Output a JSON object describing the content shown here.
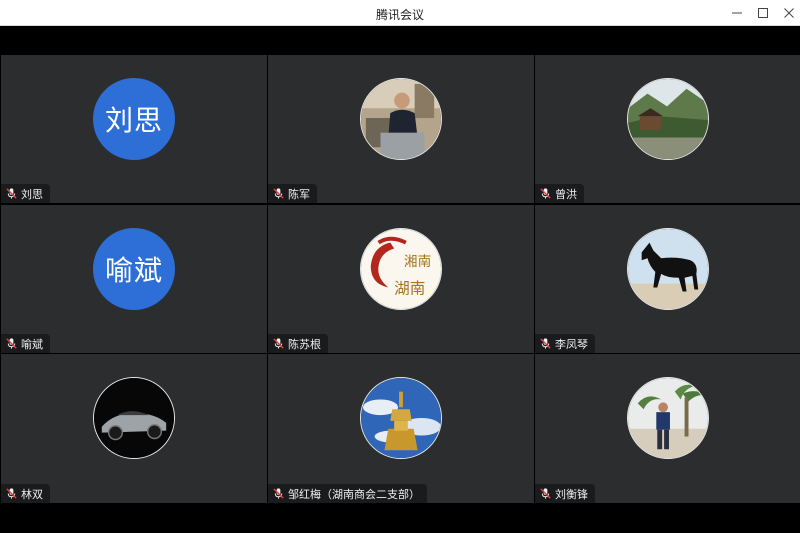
{
  "window": {
    "title": "腾讯会议"
  },
  "participants": [
    {
      "name": "刘思",
      "avatar_text": "刘思",
      "avatar": "text-avatar"
    },
    {
      "name": "陈军",
      "avatar_text": "",
      "avatar": "photo-man-at-machine"
    },
    {
      "name": "曾洪",
      "avatar_text": "",
      "avatar": "photo-village-landscape"
    },
    {
      "name": "喻斌",
      "avatar_text": "喻斌",
      "avatar": "text-avatar"
    },
    {
      "name": "陈苏根",
      "avatar_text": "",
      "avatar": "logo-hunan-calligraphy"
    },
    {
      "name": "李凤琴",
      "avatar_text": "",
      "avatar": "photo-black-horse"
    },
    {
      "name": "林双",
      "avatar_text": "",
      "avatar": "photo-silver-sports-car"
    },
    {
      "name": "邹红梅（湖南商会二支部）",
      "avatar_text": "",
      "avatar": "photo-golden-statue-sky"
    },
    {
      "name": "刘衡锋",
      "avatar_text": "",
      "avatar": "photo-man-palm-trees"
    }
  ],
  "colors": {
    "avatar_blue": "#2d6fd6",
    "tile_bg": "#2b2d2f",
    "mic_muted": "#e04040"
  }
}
